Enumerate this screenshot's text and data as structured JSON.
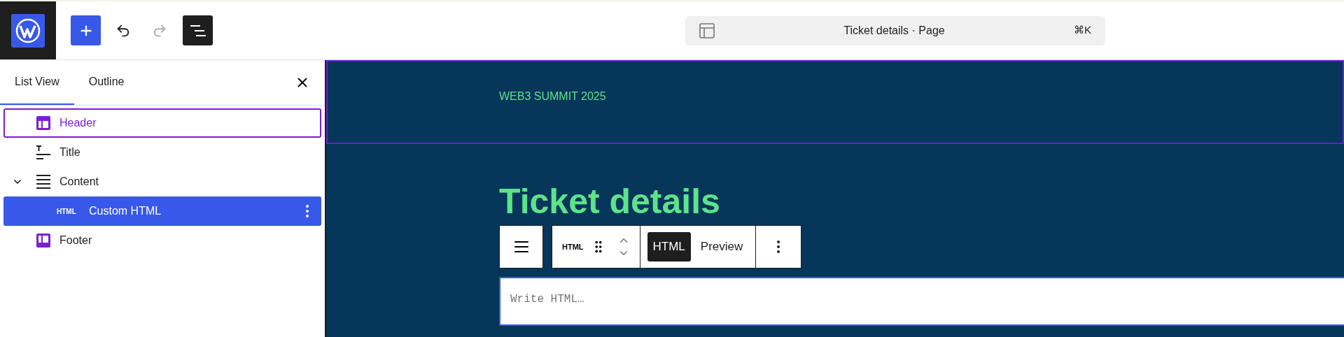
{
  "top_bar": {
    "undo_disabled": false,
    "redo_disabled": true,
    "list_view_open": true
  },
  "command_bar": {
    "title": "Ticket details · Page",
    "shortcut": "⌘K"
  },
  "sidebar": {
    "tabs": [
      {
        "label": "List View",
        "selected": true
      },
      {
        "label": "Outline",
        "selected": false
      }
    ],
    "items": [
      {
        "label": "Header",
        "kind": "header",
        "selected": false,
        "highlighted": true
      },
      {
        "label": "Title",
        "kind": "title",
        "selected": false,
        "highlighted": false
      },
      {
        "label": "Content",
        "kind": "content",
        "selected": false,
        "highlighted": false,
        "expanded": true,
        "children": [
          {
            "label": "Custom HTML",
            "kind": "html",
            "badge": "HTML",
            "selected": true,
            "highlighted": false
          }
        ]
      },
      {
        "label": "Footer",
        "kind": "footer",
        "selected": false,
        "highlighted": false
      }
    ]
  },
  "canvas": {
    "site_title": "WEB3 SUMMIT 2025",
    "page_title": "Ticket details",
    "block_toolbar": {
      "block_badge": "HTML",
      "modes": [
        {
          "label": "HTML",
          "selected": true
        },
        {
          "label": "Preview",
          "selected": false
        }
      ]
    },
    "html_field": {
      "placeholder": "Write HTML…"
    }
  }
}
